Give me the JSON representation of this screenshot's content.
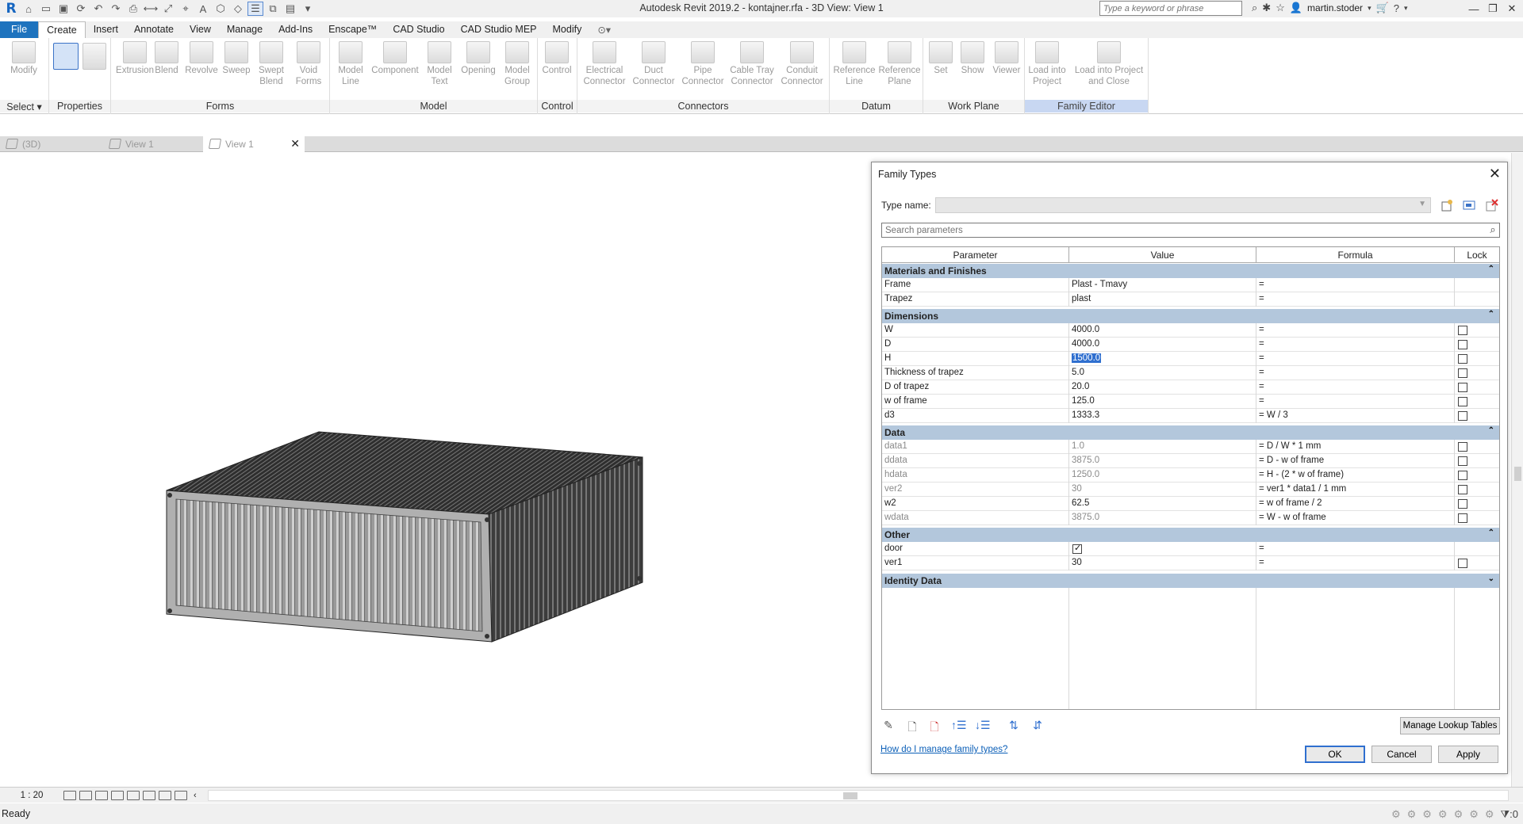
{
  "app": {
    "title": "Autodesk Revit 2019.2 - kontajner.rfa - 3D View: View 1",
    "logo": "R",
    "search_placeholder": "Type a keyword or phrase",
    "user": "martin.stoder"
  },
  "menu": [
    "File",
    "Create",
    "Insert",
    "Annotate",
    "View",
    "Manage",
    "Add-Ins",
    "Enscape™",
    "CAD Studio",
    "CAD Studio MEP",
    "Modify"
  ],
  "ribbon": {
    "panels": [
      "Select ▾",
      "Properties",
      "Forms",
      "Model",
      "Control",
      "Connectors",
      "Datum",
      "Work Plane",
      "Family Editor"
    ],
    "tools": {
      "modify": "Modify",
      "extrusion": "Extrusion",
      "blend": "Blend",
      "revolve": "Revolve",
      "sweep": "Sweep",
      "swept_blend": "Swept Blend",
      "void_forms": "Void Forms",
      "model_line": "Model Line",
      "component": "Component",
      "model_text": "Model Text",
      "opening": "Opening",
      "model_group": "Model Group",
      "control": "Control",
      "electrical_connector": "Electrical Connector",
      "duct_connector": "Duct Connector",
      "pipe_connector": "Pipe Connector",
      "cable_tray_connector": "Cable Tray Connector",
      "conduit_connector": "Conduit Connector",
      "reference_line": "Reference Line",
      "reference_plane": "Reference Plane",
      "set": "Set",
      "show": "Show",
      "viewer": "Viewer",
      "load_into_project": "Load into Project",
      "load_into_project_close": "Load into Project and Close"
    }
  },
  "view_tabs": [
    "(3D)",
    "View 1",
    "View 1"
  ],
  "view_control": {
    "scale": "1 : 20"
  },
  "status": {
    "text": "Ready",
    "filter_count": ":0"
  },
  "dialog": {
    "title": "Family Types",
    "type_name_label": "Type name:",
    "search_placeholder": "Search parameters",
    "columns": [
      "Parameter",
      "Value",
      "Formula",
      "Lock"
    ],
    "groups": [
      {
        "name": "Materials and Finishes",
        "rows": [
          {
            "param": "Frame",
            "value": "Plast - Tmavy",
            "formula": "=",
            "lock": null,
            "gray": false
          },
          {
            "param": "Trapez",
            "value": "plast",
            "formula": "=",
            "lock": null,
            "gray": false
          }
        ]
      },
      {
        "name": "Dimensions",
        "rows": [
          {
            "param": "W",
            "value": "4000.0",
            "formula": "=",
            "lock": false,
            "gray": false
          },
          {
            "param": "D",
            "value": "4000.0",
            "formula": "=",
            "lock": false,
            "gray": false
          },
          {
            "param": "H",
            "value": "1500.0",
            "formula": "=",
            "lock": false,
            "gray": false,
            "selected": true
          },
          {
            "param": "Thickness of trapez",
            "value": "5.0",
            "formula": "=",
            "lock": false,
            "gray": false
          },
          {
            "param": "D of trapez",
            "value": "20.0",
            "formula": "=",
            "lock": false,
            "gray": false
          },
          {
            "param": "w of frame",
            "value": "125.0",
            "formula": "=",
            "lock": false,
            "gray": false
          },
          {
            "param": "d3",
            "value": "1333.3",
            "formula": "= W / 3",
            "lock": false,
            "gray": false
          }
        ]
      },
      {
        "name": "Data",
        "rows": [
          {
            "param": "data1",
            "value": "1.0",
            "formula": "= D / W * 1 mm",
            "lock": false,
            "gray": true
          },
          {
            "param": "ddata",
            "value": "3875.0",
            "formula": "= D - w of frame",
            "lock": false,
            "gray": true
          },
          {
            "param": "hdata",
            "value": "1250.0",
            "formula": "= H - (2 * w of frame)",
            "lock": false,
            "gray": true
          },
          {
            "param": "ver2",
            "value": "30",
            "formula": "= ver1 * data1 / 1 mm",
            "lock": false,
            "gray": true
          },
          {
            "param": "w2",
            "value": "62.5",
            "formula": "= w of frame / 2",
            "lock": false,
            "gray": false
          },
          {
            "param": "wdata",
            "value": "3875.0",
            "formula": "= W - w of frame",
            "lock": false,
            "gray": true
          }
        ]
      },
      {
        "name": "Other",
        "rows": [
          {
            "param": "door",
            "value": "",
            "checkbox_value": true,
            "formula": "=",
            "lock": null,
            "gray": false
          },
          {
            "param": "ver1",
            "value": "30",
            "formula": "=",
            "lock": false,
            "gray": false
          }
        ]
      },
      {
        "name": "Identity Data",
        "collapsed": true,
        "rows": []
      }
    ],
    "manage_lookup_label": "Manage Lookup Tables",
    "help_link": "How do I manage family types?",
    "ok_label": "OK",
    "cancel_label": "Cancel",
    "apply_label": "Apply"
  },
  "colors": {
    "file_tab": "#1e73be",
    "group_header": "#b3c7dc",
    "selection": "#2f6fcf",
    "family_editor_panel": "#c8d7f2"
  }
}
